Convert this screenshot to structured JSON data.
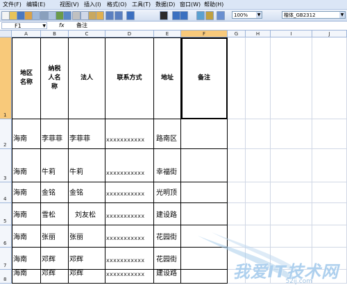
{
  "menu": [
    "文件(F)",
    "编辑(E)",
    "视图(V)",
    "插入(I)",
    "格式(O)",
    "工具(T)",
    "数据(D)",
    "窗口(W)",
    "帮助(H)"
  ],
  "toolbar": {
    "zoom": "100%",
    "font": "楷体_GB2312",
    "icons": [
      "new-icon",
      "open-icon",
      "save-icon",
      "permission-icon",
      "email-icon",
      "print-icon",
      "print-preview-icon",
      "spelling-icon",
      "research-icon",
      "cut-icon",
      "copy-icon",
      "paste-icon",
      "format-painter-icon",
      "undo-icon",
      "redo-icon",
      "hyperlink-icon",
      "autosum-icon",
      "sort-ascending-icon",
      "sort-descending-icon",
      "chart-wizard-icon",
      "drawing-icon",
      "help-icon"
    ]
  },
  "formula_bar": {
    "name_box": "F1",
    "fx": "fx",
    "value": "备注"
  },
  "columns": [
    "A",
    "B",
    "C",
    "D",
    "E",
    "F",
    "G",
    "H",
    "I",
    "J"
  ],
  "selected_column": "F",
  "rows": [
    "1",
    "2",
    "3",
    "4",
    "5",
    "6",
    "7",
    "8"
  ],
  "header_row": [
    "地区名称",
    "纳税人名称",
    "法人",
    "联系方式",
    "地址",
    "备注"
  ],
  "data_rows": [
    [
      "海南",
      "李菲菲",
      "李菲菲",
      "xxxxxxxxxxx",
      "路南区",
      ""
    ],
    [
      "海南",
      "牛莉",
      "牛莉",
      "xxxxxxxxxxx",
      "幸福街",
      ""
    ],
    [
      "海南",
      "金铭",
      "金铭",
      "xxxxxxxxxxx",
      "光明顶",
      ""
    ],
    [
      "海南",
      "雪松",
      "刘友松",
      "xxxxxxxxxxx",
      "建设路",
      ""
    ],
    [
      "海南",
      "张丽",
      "张丽",
      "xxxxxxxxxxx",
      "花园街",
      ""
    ],
    [
      "海南",
      "邓辉",
      "邓辉",
      "xxxxxxxxxxx",
      "花园街",
      ""
    ],
    [
      "海南",
      "邓辉",
      "邓辉",
      "xxxxxxxxxxx",
      "建设路",
      ""
    ]
  ],
  "watermark": {
    "text": "我爱IT技术网",
    "url": "52ij.com"
  }
}
